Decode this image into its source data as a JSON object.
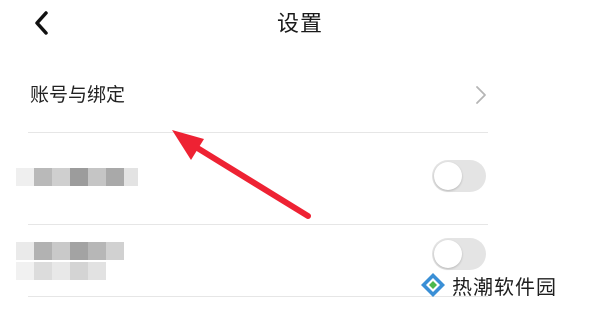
{
  "header": {
    "title": "设置"
  },
  "settings": {
    "account_label": "账号与绑定",
    "toggle_1": {
      "label": "",
      "state": "off"
    },
    "toggle_2": {
      "label": "",
      "state": "off"
    }
  },
  "watermark": {
    "text": "热潮软件园"
  },
  "colors": {
    "annotation_arrow": "#ee2233",
    "toggle_off": "#e4e4e4",
    "divider": "#e6e6e6"
  },
  "icons": {
    "back": "back-arrow-icon",
    "chevron": "chevron-right-icon",
    "watermark_logo": "diamond-logo-icon"
  }
}
